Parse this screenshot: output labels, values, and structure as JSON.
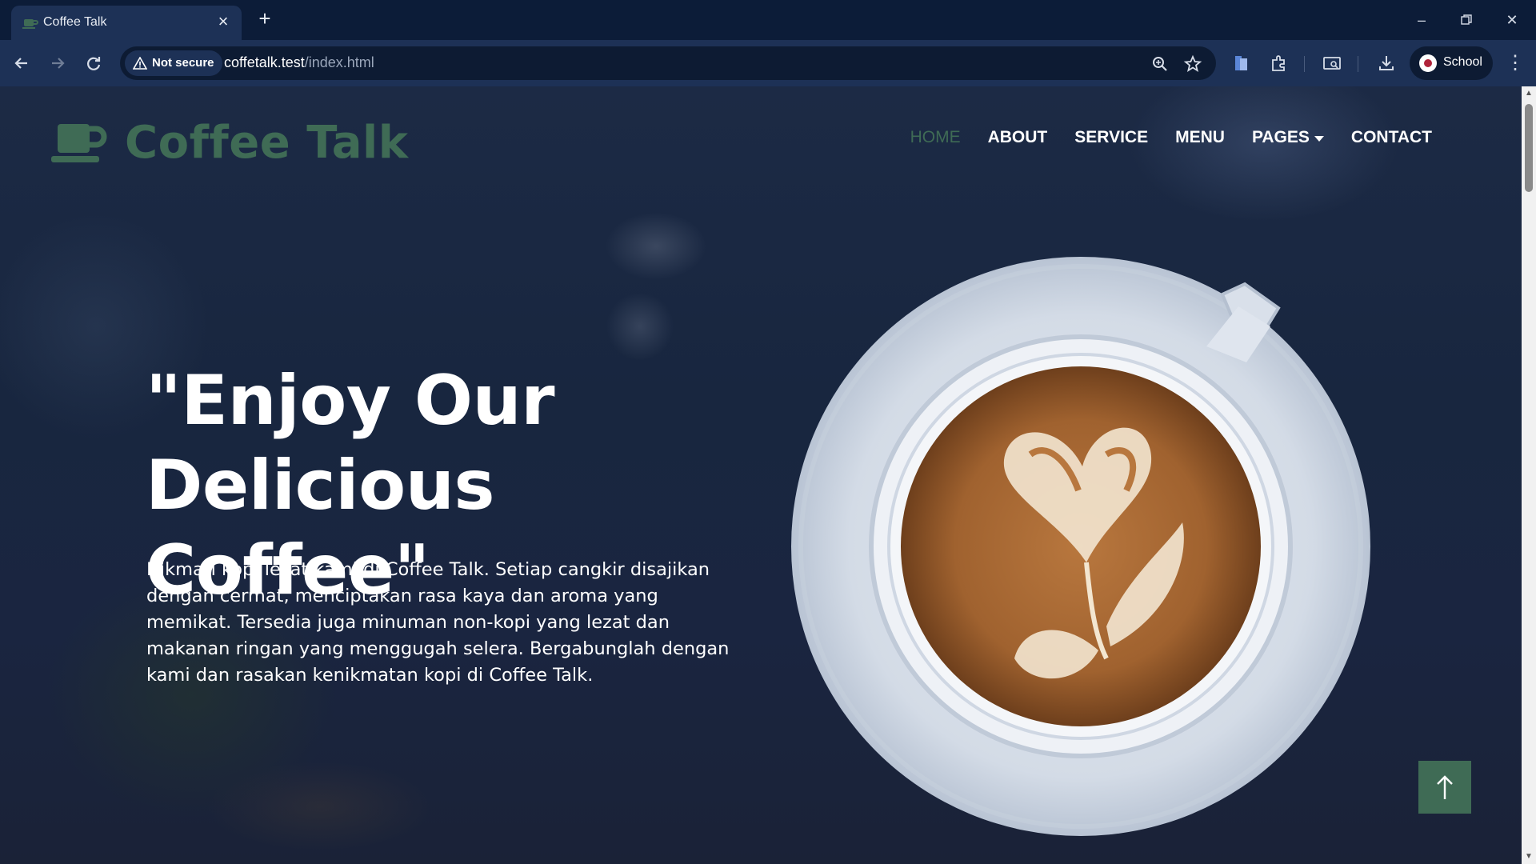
{
  "browser": {
    "tab_title": "Coffee Talk",
    "security_label": "Not secure",
    "url_host": "coffetalk.test",
    "url_path": "/index.html",
    "profile_label": "School"
  },
  "site": {
    "logo_text": "Coffee Talk",
    "nav": [
      {
        "label": "HOME",
        "active": true
      },
      {
        "label": "ABOUT"
      },
      {
        "label": "SERVICE"
      },
      {
        "label": "MENU"
      },
      {
        "label": "PAGES"
      },
      {
        "label": "CONTACT"
      }
    ],
    "hero": {
      "title_line1": "\"Enjoy Our",
      "title_line2": "Delicious Coffee\"",
      "description": "Nikmati kopi lezat kami di Coffee Talk. Setiap cangkir disajikan dengan cermat, menciptakan rasa kaya dan aroma yang memikat. Tersedia juga minuman non-kopi yang lezat dan makanan ringan yang menggugah selera. Bergabunglah dengan kami dan rasakan kenikmatan kopi di Coffee Talk."
    }
  },
  "colors": {
    "brand_green": "#3f6b55",
    "chrome_dark": "#0c1c38",
    "chrome_toolbar": "#1d3156"
  },
  "icons": [
    "coffee-cup-icon",
    "close-icon",
    "plus-icon",
    "back-arrow-icon",
    "forward-arrow-icon",
    "reload-icon",
    "warning-icon",
    "zoom-icon",
    "star-icon",
    "arrow-up-icon"
  ]
}
